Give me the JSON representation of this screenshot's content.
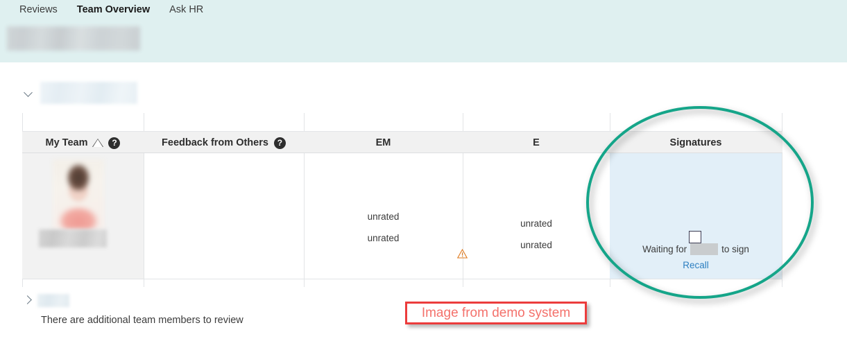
{
  "nav": {
    "tabs": [
      {
        "label": "Reviews",
        "active": false
      },
      {
        "label": "Team Overview",
        "active": true
      },
      {
        "label": "Ask HR",
        "active": false
      }
    ]
  },
  "table": {
    "columns": [
      {
        "key": "my_team",
        "label": "My Team",
        "sort_icon": "sort-triangle-icon",
        "help_icon": "help-circle-icon",
        "help_glyph": "?"
      },
      {
        "key": "feedback",
        "label": "Feedback from Others",
        "help_icon": "help-circle-icon",
        "help_glyph": "?"
      },
      {
        "key": "em",
        "label": "EM"
      },
      {
        "key": "e",
        "label": "E"
      },
      {
        "key": "signatures",
        "label": "Signatures"
      }
    ],
    "row": {
      "my_team": {
        "avatar": "employee-photo-redacted",
        "name": "[redacted]"
      },
      "feedback": "",
      "em": {
        "values": [
          "unrated",
          "unrated"
        ],
        "warning_icon": "warning-triangle-icon"
      },
      "e": {
        "values": [
          "unrated",
          "unrated"
        ],
        "warning_icon": "warning-triangle-icon"
      },
      "signatures": {
        "checkbox_icon": "unchecked-checkbox-icon",
        "waiting_prefix": "Waiting for",
        "waiting_name": "[redacted]",
        "waiting_suffix": "to sign",
        "recall_label": "Recall"
      }
    }
  },
  "groups": {
    "expanded": {
      "chevron_icon": "chevron-down-icon",
      "label": "[redacted]"
    },
    "collapsed": {
      "chevron_icon": "chevron-right-icon",
      "label": "[redacted]"
    }
  },
  "footer": {
    "additional_members_note": "There are additional team members to review"
  },
  "annotations": {
    "circle": {
      "shape": "ellipse-highlight",
      "color": "#15a589"
    },
    "callout_text": "Image from demo system",
    "callout_border_color": "#ec3c3c",
    "callout_text_color": "#f4716b"
  },
  "colors": {
    "top_band": "#dff0f0",
    "header_row": "#f1f1f1",
    "myteam_cell": "#f2f2f2",
    "signatures_cell": "#e2eff8",
    "link": "#2d7fc1",
    "warning": "#e07b1f"
  }
}
